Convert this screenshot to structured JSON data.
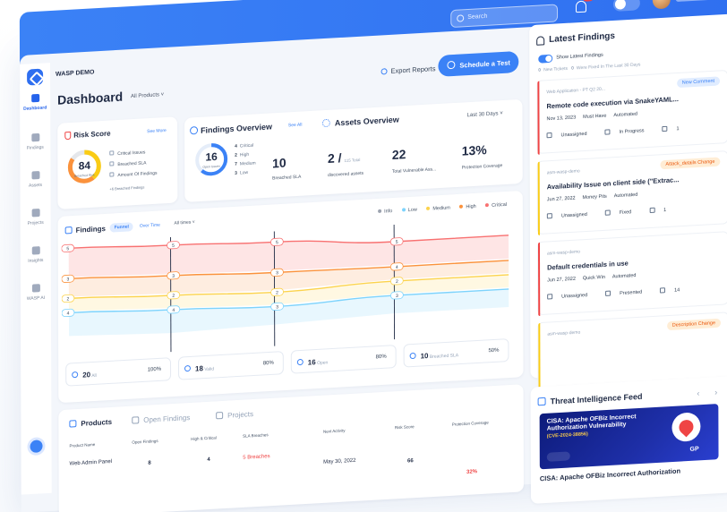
{
  "topbar": {
    "search_placeholder": "Search",
    "notification_count": "76"
  },
  "sidebar": {
    "items": [
      {
        "label": "Dashboard"
      },
      {
        "label": "Findings"
      },
      {
        "label": "Assets"
      },
      {
        "label": "Projects"
      },
      {
        "label": "Insights"
      },
      {
        "label": "WASP AI"
      }
    ]
  },
  "header": {
    "org": "WASP DEMO",
    "title": "Dashboard",
    "products_filter": "All Products",
    "export_label": "Export Reports",
    "schedule_label": "Schedule a Test"
  },
  "risk_score": {
    "title": "Risk Score",
    "see_more": "See More",
    "value": "84",
    "value_caption": "Breached Risk",
    "items": [
      "Critical Issues",
      "Breached SLA",
      "Amount Of Findings"
    ],
    "footer": "+6 Breached Findings"
  },
  "findings_overview": {
    "title": "Findings Overview",
    "see_all": "See All",
    "total": "16",
    "total_caption": "Open Issues",
    "severities": [
      {
        "count": "4",
        "label": "Critical"
      },
      {
        "count": "2",
        "label": "High"
      },
      {
        "count": "7",
        "label": "Medium"
      },
      {
        "count": "3",
        "label": "Low"
      }
    ],
    "breached_value": "10",
    "breached_label": "Breached SLA"
  },
  "assets_overview": {
    "title": "Assets Overview",
    "period": "Last 30 Days",
    "discovered_value": "2 /",
    "discovered_total": "115 Total",
    "discovered_label": "discovered assets",
    "vulnerable_value": "22",
    "vulnerable_label": "Total Vulnerable Ass...",
    "coverage_value": "13%",
    "coverage_label": "Protection Coverage"
  },
  "findings_chart": {
    "title": "Findings",
    "toggle_on": "Funnel",
    "toggle_off": "Over Time",
    "range": "All times",
    "legend": [
      {
        "label": "Info",
        "color": "#9ca3af"
      },
      {
        "label": "Low",
        "color": "#7dd3fc"
      },
      {
        "label": "Medium",
        "color": "#fcd34d"
      },
      {
        "label": "High",
        "color": "#fb923c"
      },
      {
        "label": "Critical",
        "color": "#f87171"
      }
    ],
    "node_labels": [
      [
        "5",
        "5",
        "5",
        "5"
      ],
      [
        "3",
        "3",
        "3",
        "4"
      ],
      [
        "2",
        "2",
        "2",
        "2"
      ],
      [
        "4",
        "4",
        "3",
        "3"
      ]
    ],
    "stats": [
      {
        "value": "20",
        "label": "All",
        "pct": "100%"
      },
      {
        "value": "18",
        "label": "Valid",
        "pct": "80%"
      },
      {
        "value": "16",
        "label": "Open",
        "pct": "80%"
      },
      {
        "value": "10",
        "label": "Breached SLA",
        "pct": "50%"
      }
    ]
  },
  "chart_data": {
    "type": "area",
    "x": [
      "All",
      "Valid",
      "Open",
      "Breached SLA"
    ],
    "series": [
      {
        "name": "Critical",
        "values": [
          5,
          5,
          5,
          4
        ]
      },
      {
        "name": "High",
        "values": [
          3,
          3,
          3,
          2
        ]
      },
      {
        "name": "Medium",
        "values": [
          2,
          2,
          2,
          2
        ]
      },
      {
        "name": "Low",
        "values": [
          4,
          4,
          3,
          3
        ]
      }
    ],
    "legend_position": "top-right"
  },
  "products": {
    "tabs": [
      "Products",
      "Open Findings",
      "Projects"
    ],
    "headers": [
      "Product Name",
      "Open Findings",
      "High & Critical",
      "SLA Breaches",
      "Next Activity",
      "Risk Score",
      "Protection Coverage"
    ],
    "row": {
      "name": "Web Admin Panel",
      "open": "8",
      "high_critical": "4",
      "sla": "5 Breaches",
      "next": "May 30, 2022",
      "risk": "66",
      "coverage": "32%"
    }
  },
  "latest_findings": {
    "title": "Latest Findings",
    "toggle_label": "Show Latest Findings",
    "new_count": "0",
    "new_label": "New Tickets",
    "fixed_count": "0",
    "fixed_label": "Were Fixed In The Last 30 Days",
    "items": [
      {
        "org": "Web Application - PT Q2 20...",
        "tag": "New Comment",
        "tag_bg": "#e0ecff",
        "tag_color": "#3b82f6",
        "bar": "#ef4444",
        "title": "Remote code execution via SnakeYAML...",
        "date": "Nov 13, 2023",
        "priority": "Must Have",
        "type": "Automated",
        "assignee": "Unassigned",
        "status": "In Progress",
        "comments": "1"
      },
      {
        "org": "asm-wasp-demo",
        "tag": "Attack_details Change",
        "tag_bg": "#ffedd5",
        "tag_color": "#ea580c",
        "bar": "#facc15",
        "title": "Availability Issue on client side (\"Extrac...",
        "date": "Jun 27, 2022",
        "priority": "Money Pits",
        "type": "Automated",
        "assignee": "Unassigned",
        "status": "Fixed",
        "comments": "1"
      },
      {
        "org": "asm-wasp-demo",
        "tag": "",
        "tag_bg": "#ffffff",
        "tag_color": "#ffffff",
        "bar": "#ef4444",
        "title": "Default credentials in use",
        "date": "Jun 27, 2022",
        "priority": "Quick Win",
        "type": "Automated",
        "assignee": "Unassigned",
        "status": "Presented",
        "comments": "14"
      },
      {
        "org": "asm-wasp-demo",
        "tag": "Description Change",
        "tag_bg": "#ffedd5",
        "tag_color": "#ea580c",
        "bar": "#facc15",
        "title": "",
        "date": "",
        "priority": "",
        "type": "",
        "assignee": "",
        "status": "",
        "comments": ""
      }
    ]
  },
  "threat_feed": {
    "title": "Threat Intelligence Feed",
    "banner_title": "CISA: Apache OFBiz Incorrect Authorization Vulnerability",
    "banner_cve": "(CVE-2024-38856)",
    "banner_brand": "GP",
    "caption": "CISA: Apache OFBiz Incorrect Authorization"
  }
}
